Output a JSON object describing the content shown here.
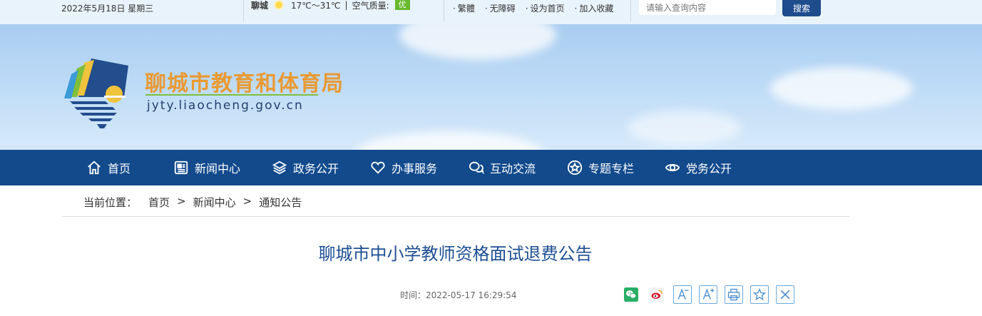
{
  "topbar": {
    "date": "2022年5月18日  星期三",
    "city": "聊城",
    "temperature": "17℃～31℃",
    "air_quality_label": "空气质量:",
    "air_quality_value": "优",
    "links": [
      "繁體",
      "无障碍",
      "设为首页",
      "加入收藏"
    ],
    "search_placeholder": "请输入查询内容",
    "search_button": "搜索"
  },
  "banner": {
    "site_name": "聊城市教育和体育局",
    "site_url": "jyty.liaocheng.gov.cn"
  },
  "nav": [
    {
      "label": "首页",
      "icon": "home-icon"
    },
    {
      "label": "新闻中心",
      "icon": "newspaper-icon"
    },
    {
      "label": "政务公开",
      "icon": "layers-icon"
    },
    {
      "label": "办事服务",
      "icon": "heart-icon"
    },
    {
      "label": "互动交流",
      "icon": "chat-icon"
    },
    {
      "label": "专题专栏",
      "icon": "star-circle-icon"
    },
    {
      "label": "党务公开",
      "icon": "eye-icon"
    }
  ],
  "breadcrumb": {
    "prefix": "当前位置：",
    "items": [
      "首页",
      "新闻中心",
      "通知公告"
    ],
    "separator": ">"
  },
  "article": {
    "title": "聊城市中小学教师资格面试退费公告",
    "time": "时间：2022-05-17 16:29:54"
  },
  "share_tools": [
    "wechat-icon",
    "weibo-icon",
    "font-decrease-icon",
    "font-increase-icon",
    "print-icon",
    "favorite-icon",
    "close-icon"
  ],
  "colors": {
    "nav_bg": "#124a8c",
    "title": "#1d4e93",
    "logo_text": "#e99a33",
    "accent_green": "#66b82c"
  }
}
